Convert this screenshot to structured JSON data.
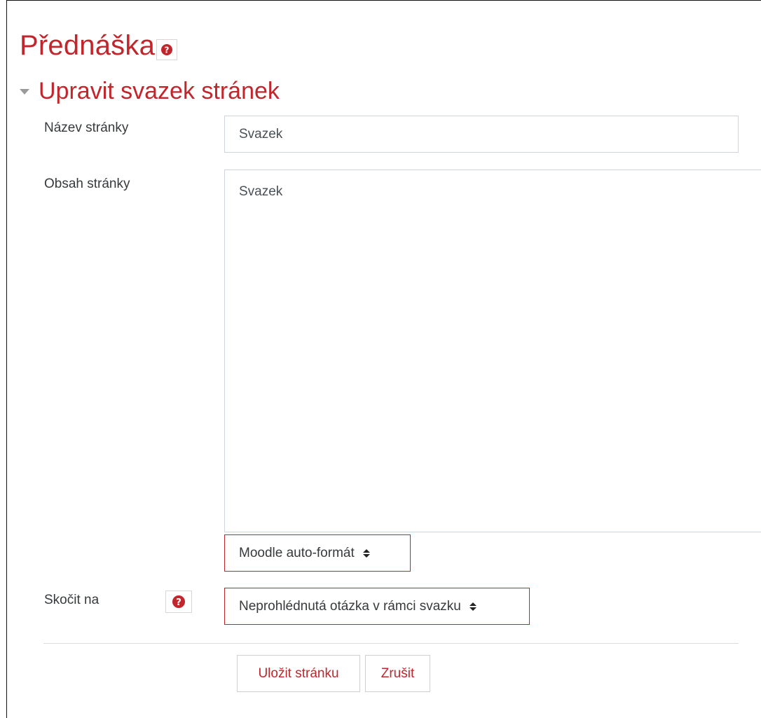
{
  "page": {
    "title": "Přednáška",
    "help_icon": "question-circle-icon"
  },
  "section": {
    "title": "Upravit svazek stránek",
    "toggle_icon": "caret-down-icon"
  },
  "fields": {
    "page_name": {
      "label": "Název stránky",
      "value": "Svazek"
    },
    "page_content": {
      "label": "Obsah stránky",
      "value": "Svazek"
    },
    "format": {
      "selected": "Moodle auto-formát"
    },
    "jump_to": {
      "label": "Skočit na",
      "selected": "Neprohlédnutá otázka v rámci svazku",
      "help_icon": "question-circle-icon"
    }
  },
  "buttons": {
    "save_label": "Uložit stránku",
    "cancel_label": "Zrušit"
  },
  "colors": {
    "accent": "#c0262c",
    "border": "#ced4da",
    "text": "#373a3c"
  }
}
